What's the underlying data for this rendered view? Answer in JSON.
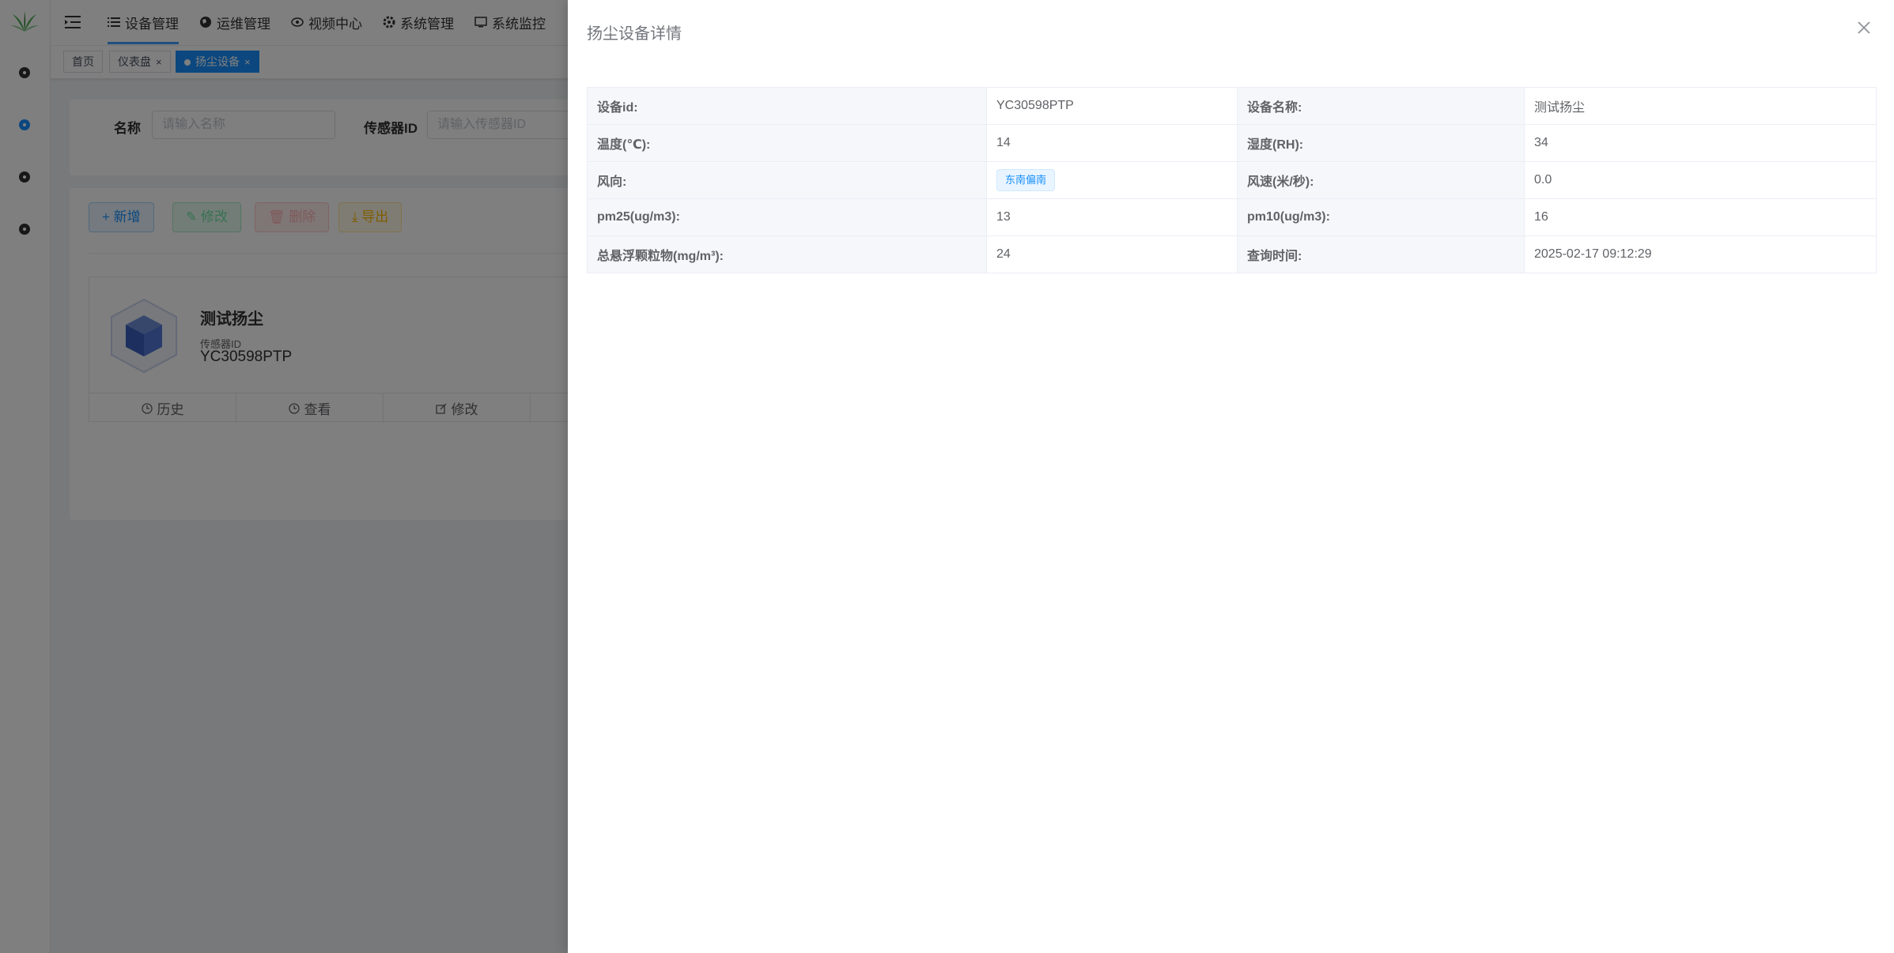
{
  "colors": {
    "primary": "#1890ff",
    "mask": "rgba(0,0,0,0.5)",
    "label_bg": "#f6f7fb"
  },
  "topnav": {
    "items": [
      {
        "label": "设备管理",
        "icon": "list-icon"
      },
      {
        "label": "运维管理",
        "icon": "globe-icon"
      },
      {
        "label": "视频中心",
        "icon": "eye-icon"
      },
      {
        "label": "系统管理",
        "icon": "gear-icon"
      },
      {
        "label": "系统监控",
        "icon": "monitor-icon"
      }
    ]
  },
  "tags": {
    "home": "首页",
    "dashboard": "仪表盘",
    "current": "扬尘设备",
    "close": "×"
  },
  "search": {
    "name_label": "名称",
    "name_placeholder": "请输入名称",
    "sensor_label": "传感器ID",
    "sensor_placeholder": "请输入传感器ID"
  },
  "toolbar": {
    "add": "新增",
    "edit": "修改",
    "delete": "删除",
    "export": "导出"
  },
  "device_card": {
    "name": "测试扬尘",
    "sensor_label": "传感器ID",
    "sensor_id": "YC30598PTP",
    "actions": {
      "history": "历史",
      "view": "查看",
      "edit": "修改"
    }
  },
  "drawer": {
    "title": "扬尘设备详情",
    "rows": [
      {
        "l1": "设备id:",
        "v1": "YC30598PTP",
        "l2": "设备名称:",
        "v2": "测试扬尘"
      },
      {
        "l1": "温度(℃):",
        "v1": "14",
        "l2": "湿度(RH):",
        "v2": "34"
      },
      {
        "l1": "风向:",
        "v1": "东南偏南",
        "l2": "风速(米/秒):",
        "v2": "0.0"
      },
      {
        "l1": "pm25(ug/m3):",
        "v1": "13",
        "l2": "pm10(ug/m3):",
        "v2": "16"
      },
      {
        "l1": "总悬浮颗粒物(mg/m³):",
        "v1": "24",
        "l2": "查询时间:",
        "v2": "2025-02-17 09:12:29"
      }
    ]
  }
}
